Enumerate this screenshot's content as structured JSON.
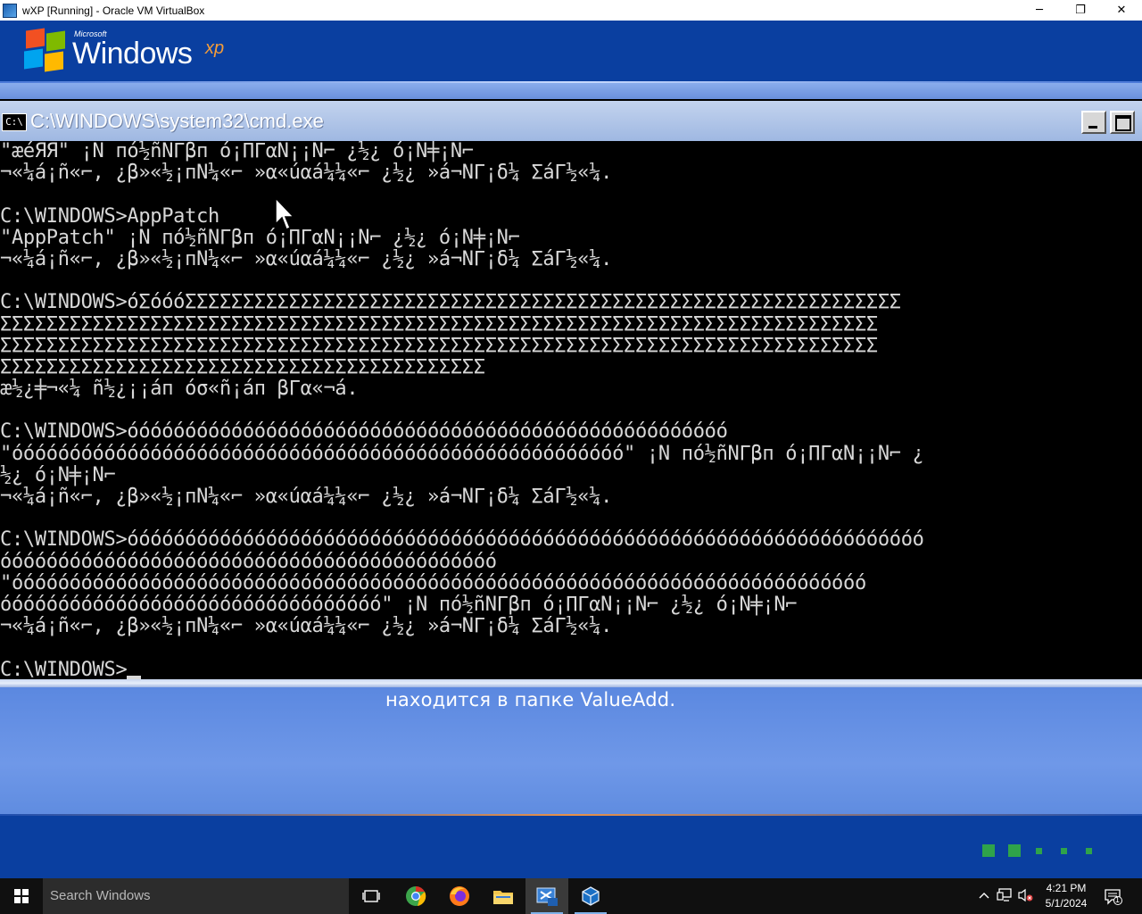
{
  "host_window": {
    "title": "wXP [Running] - Oracle VM VirtualBox",
    "controls": [
      "─",
      "❐",
      "✕"
    ]
  },
  "xp_setup": {
    "logo": {
      "microsoft": "Microsoft",
      "windows": "Windows",
      "xp": "xp"
    },
    "message": "находится в папке ValueAdd.",
    "progress_dots": 5
  },
  "cmd": {
    "title": "C:\\WINDOWS\\system32\\cmd.exe",
    "icon_label": "C:\\",
    "lines": [
      "\"æéЯЯ\" ¡Ñ пó½ñÑΓβп ó¡ΠΓαÑ¡¡Ñ⌐ ¿½¿ ó¡Ñ╪¡Ñ⌐",
      "¬«¼á¡ñ«⌐, ¿β»«½¡пÑ¼«⌐ »α«úαá¼¼«⌐ ¿½¿ »á¬ÑΓ¡δ¼ ΣáΓ½«¼.",
      "",
      "C:\\WINDOWS>AppPatch",
      "\"AppPatch\" ¡Ñ пó½ñÑΓβп ó¡ΠΓαÑ¡¡Ñ⌐ ¿½¿ ó¡Ñ╪¡Ñ⌐",
      "¬«¼á¡ñ«⌐, ¿β»«½¡пÑ¼«⌐ »α«úαá¼¼«⌐ ¿½¿ »á¬ÑΓ¡δ¼ ΣáΓ½«¼.",
      "",
      "C:\\WINDOWS>óΣóóóΣΣΣΣΣΣΣΣΣΣΣΣΣΣΣΣΣΣΣΣΣΣΣΣΣΣΣΣΣΣΣΣΣΣΣΣΣΣΣΣΣΣΣΣΣΣΣΣΣΣΣΣΣΣΣΣΣΣΣΣΣΣ",
      "ΣΣΣΣΣΣΣΣΣΣΣΣΣΣΣΣΣΣΣΣΣΣΣΣΣΣΣΣΣΣΣΣΣΣΣΣΣΣΣΣΣΣΣΣΣΣΣΣΣΣΣΣΣΣΣΣΣΣΣΣΣΣΣΣΣΣΣΣΣΣΣΣΣΣΣΣ",
      "ΣΣΣΣΣΣΣΣΣΣΣΣΣΣΣΣΣΣΣΣΣΣΣΣΣΣΣΣΣΣΣΣΣΣΣΣΣΣΣΣΣΣΣΣΣΣΣΣΣΣΣΣΣΣΣΣΣΣΣΣΣΣΣΣΣΣΣΣΣΣΣΣΣΣΣΣ",
      "ΣΣΣΣΣΣΣΣΣΣΣΣΣΣΣΣΣΣΣΣΣΣΣΣΣΣΣΣΣΣΣΣΣΣΣΣΣΣΣΣΣΣ",
      "æ½¿╪¬«¼ ñ½¿¡¡áп óσ«ñ¡áп βΓα«¬á.",
      "",
      "C:\\WINDOWS>óóóóóóóóóóóóóóóóóóóóóóóóóóóóóóóóóóóóóóóóóóóóóóóóóóóó",
      "\"óóóóóóóóóóóóóóóóóóóóóóóóóóóóóóóóóóóóóóóóóóóóóóóóóóóóó\" ¡Ñ пó½ñÑΓβп ó¡ΠΓαÑ¡¡Ñ⌐ ¿",
      "½¿ ó¡Ñ╪¡Ñ⌐",
      "¬«¼á¡ñ«⌐, ¿β»«½¡пÑ¼«⌐ »α«úαá¼¼«⌐ ¿½¿ »á¬ÑΓ¡δ¼ ΣáΓ½«¼.",
      "",
      "C:\\WINDOWS>óóóóóóóóóóóóóóóóóóóóóóóóóóóóóóóóóóóóóóóóóóóóóóóóóóóóóóóóóóóóóóóóóóóóó",
      "óóóóóóóóóóóóóóóóóóóóóóóóóóóóóóóóóóóóóóóóóóó",
      "\"óóóóóóóóóóóóóóóóóóóóóóóóóóóóóóóóóóóóóóóóóóóóóóóóóóóóóóóóóóóóóóóóóóóóóóóóóó",
      "óóóóóóóóóóóóóóóóóóóóóóóóóóóóóóóóó\" ¡Ñ пó½ñÑΓβп ó¡ΠΓαÑ¡¡Ñ⌐ ¿½¿ ó¡Ñ╪¡Ñ⌐",
      "¬«¼á¡ñ«⌐, ¿β»«½¡пÑ¼«⌐ »α«úαá¼¼«⌐ ¿½¿ »á¬ÑΓ¡δ¼ ΣáΓ½«¼.",
      "",
      "C:\\WINDOWS>"
    ]
  },
  "taskbar": {
    "search_placeholder": "Search Windows",
    "apps": [
      "task-view-icon",
      "chrome-icon",
      "firefox-icon",
      "file-explorer-icon",
      "virtualbox-xp-icon",
      "virtualbox-icon"
    ],
    "clock": {
      "time": "4:21 PM",
      "date": "5/1/2024"
    },
    "notification_count": "1"
  }
}
